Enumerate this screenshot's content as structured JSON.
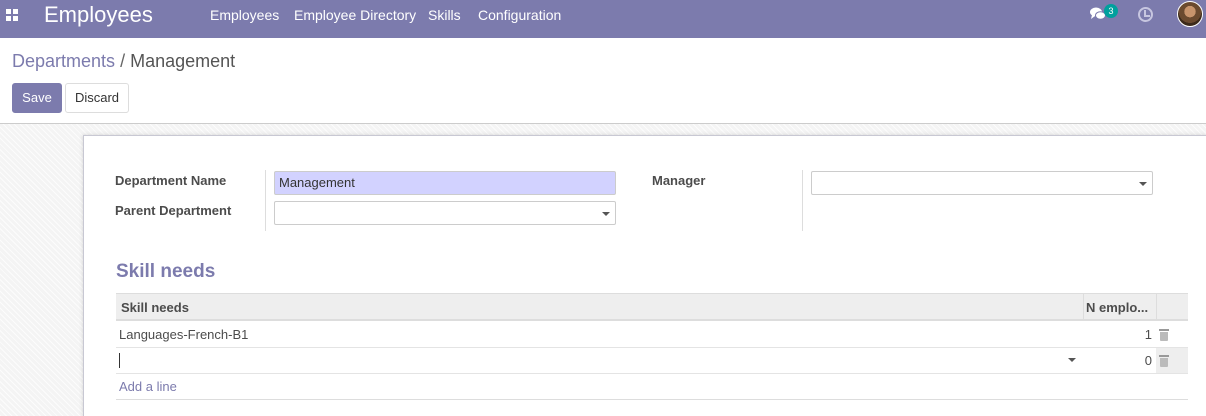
{
  "nav": {
    "app_title": "Employees",
    "menu": [
      "Employees",
      "Employee Directory",
      "Skills",
      "Configuration"
    ],
    "chat_badge": "3",
    "color": "#7c7bad"
  },
  "breadcrumb": {
    "parent": "Departments",
    "separator": "/",
    "current": "Management"
  },
  "buttons": {
    "save": "Save",
    "discard": "Discard"
  },
  "form": {
    "department_name_label": "Department Name",
    "department_name_value": "Management",
    "parent_department_label": "Parent Department",
    "parent_department_value": "",
    "manager_label": "Manager",
    "manager_value": ""
  },
  "skills": {
    "section_title": "Skill needs",
    "columns": [
      "Skill needs",
      "N emplo..."
    ],
    "rows": [
      {
        "skill": "Languages-French-B1",
        "count": "1"
      },
      {
        "skill": "",
        "count": "0"
      }
    ],
    "add_line": "Add a line"
  }
}
